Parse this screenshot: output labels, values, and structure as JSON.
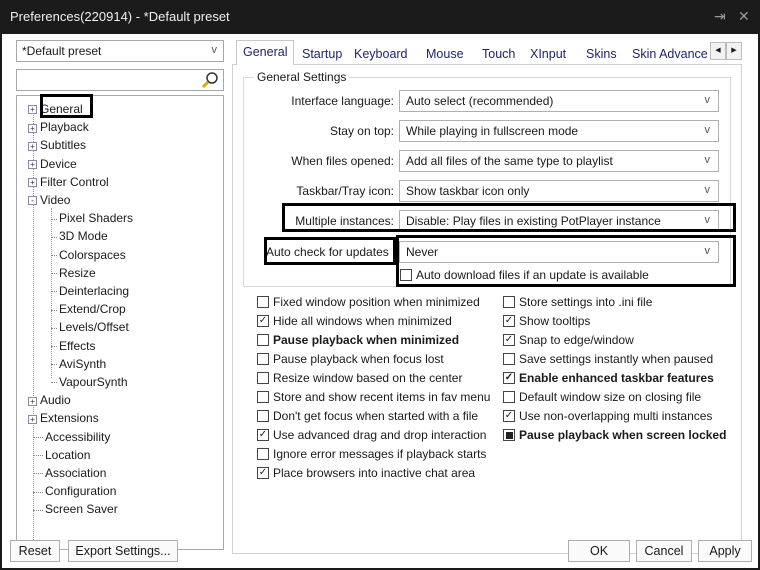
{
  "window": {
    "title": "Preferences(220914) - *Default preset",
    "pin_icon": "pin-icon",
    "close_icon": "close-icon"
  },
  "sidebar": {
    "preset_value": "*Default preset",
    "search_placeholder": "",
    "search_icon": "search-icon",
    "tree": [
      {
        "label": "General",
        "level": 0,
        "expander": "+",
        "selected": true
      },
      {
        "label": "Playback",
        "level": 0,
        "expander": "+"
      },
      {
        "label": "Subtitles",
        "level": 0,
        "expander": "+"
      },
      {
        "label": "Device",
        "level": 0,
        "expander": "+"
      },
      {
        "label": "Filter Control",
        "level": 0,
        "expander": "+"
      },
      {
        "label": "Video",
        "level": 0,
        "expander": "-"
      },
      {
        "label": "Pixel Shaders",
        "level": 1
      },
      {
        "label": "3D Mode",
        "level": 1
      },
      {
        "label": "Colorspaces",
        "level": 1
      },
      {
        "label": "Resize",
        "level": 1
      },
      {
        "label": "Deinterlacing",
        "level": 1
      },
      {
        "label": "Extend/Crop",
        "level": 1
      },
      {
        "label": "Levels/Offset",
        "level": 1
      },
      {
        "label": "Effects",
        "level": 1
      },
      {
        "label": "AviSynth",
        "level": 1
      },
      {
        "label": "VapourSynth",
        "level": 1
      },
      {
        "label": "Audio",
        "level": 0,
        "expander": "+"
      },
      {
        "label": "Extensions",
        "level": 0,
        "expander": "+"
      },
      {
        "label": "Accessibility",
        "level": 0
      },
      {
        "label": "Location",
        "level": 0
      },
      {
        "label": "Association",
        "level": 0
      },
      {
        "label": "Configuration",
        "level": 0
      },
      {
        "label": "Screen Saver",
        "level": 0
      }
    ]
  },
  "tabs": [
    "General",
    "Startup",
    "Keyboard",
    "Mouse",
    "Touch",
    "XInput",
    "Skins",
    "Skin Advance"
  ],
  "active_tab": "General",
  "general_settings": {
    "group_title": "General Settings",
    "rows": [
      {
        "label": "Interface language:",
        "value": "Auto select (recommended)"
      },
      {
        "label": "Stay on top:",
        "value": "While playing in fullscreen mode"
      },
      {
        "label": "When files opened:",
        "value": "Add all files of the same type to playlist"
      },
      {
        "label": "Taskbar/Tray icon:",
        "value": "Show taskbar icon only"
      },
      {
        "label": "Multiple instances:",
        "value": "Disable: Play files in existing PotPlayer instance"
      },
      {
        "label": "Auto check for updates",
        "value": "Never"
      }
    ],
    "auto_download": {
      "label": "Auto download files if an update is available",
      "checked": false
    }
  },
  "options_left": [
    {
      "label": "Fixed window position when minimized",
      "checked": false,
      "bold": false
    },
    {
      "label": "Hide all windows when minimized",
      "checked": true,
      "bold": false
    },
    {
      "label": "Pause playback when minimized",
      "checked": false,
      "bold": true
    },
    {
      "label": "Pause playback when focus lost",
      "checked": false,
      "bold": false
    },
    {
      "label": "Resize window based on the center",
      "checked": false,
      "bold": false
    },
    {
      "label": "Store and show recent items in fav menu",
      "checked": false,
      "bold": false
    },
    {
      "label": "Don't get focus when started with a file",
      "checked": false,
      "bold": false
    },
    {
      "label": "Use advanced drag and drop interaction",
      "checked": true,
      "bold": false
    },
    {
      "label": "Ignore error messages if playback starts",
      "checked": false,
      "bold": false
    },
    {
      "label": "Place browsers into inactive chat area",
      "checked": true,
      "bold": false
    }
  ],
  "options_right": [
    {
      "label": "Store settings into .ini file",
      "checked": false,
      "bold": false
    },
    {
      "label": "Show tooltips",
      "checked": true,
      "bold": false
    },
    {
      "label": "Snap to edge/window",
      "checked": true,
      "bold": false
    },
    {
      "label": "Save settings instantly when paused",
      "checked": false,
      "bold": false
    },
    {
      "label": "Enable enhanced taskbar features",
      "checked": true,
      "bold": true
    },
    {
      "label": "Default window size on closing file",
      "checked": false,
      "bold": false
    },
    {
      "label": "Use non-overlapping multi instances",
      "checked": true,
      "bold": false
    },
    {
      "label": "Pause playback when screen locked",
      "checked": "indeterminate",
      "bold": true
    }
  ],
  "footer": {
    "reset": "Reset",
    "export": "Export Settings...",
    "ok": "OK",
    "cancel": "Cancel",
    "apply": "Apply"
  }
}
